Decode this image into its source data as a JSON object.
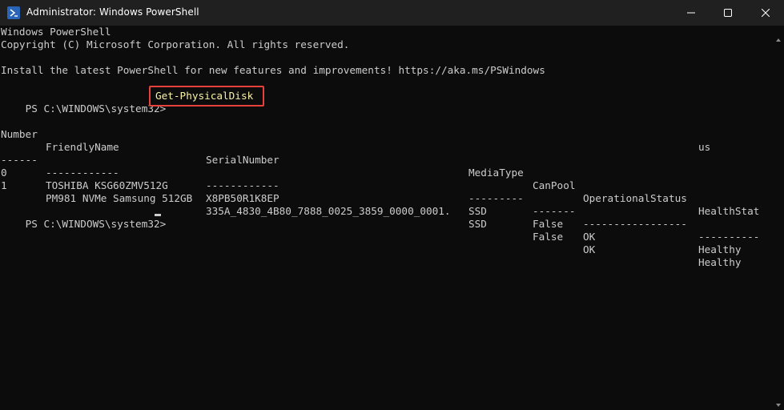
{
  "window": {
    "title": "Administrator: Windows PowerShell",
    "minimize_icon": "minimize-icon",
    "maximize_icon": "maximize-icon",
    "close_icon": "close-icon"
  },
  "console": {
    "banner_line1": "Windows PowerShell",
    "banner_line2": "Copyright (C) Microsoft Corporation. All rights reserved.",
    "banner_line3": "Install the latest PowerShell for new features and improvements! https://aka.ms/PSWindows",
    "prompt1": "PS C:\\WINDOWS\\system32>",
    "command": "Get-PhysicalDisk",
    "prompt2": "PS C:\\WINDOWS\\system32>"
  },
  "table": {
    "headers": {
      "number": "Number",
      "friendly_name": "FriendlyName",
      "serial_number": "SerialNumber",
      "media_type": "MediaType",
      "can_pool": "CanPool",
      "operational_status": "OperationalStatus",
      "health_status_a": "HealthStat",
      "health_status_b": "us"
    },
    "separators": {
      "number": "------",
      "friendly_name": "------------",
      "serial_number": "------------",
      "media_type": "---------",
      "can_pool": "-------",
      "operational_status": "-----------------",
      "health_status": "----------"
    },
    "rows": [
      {
        "number": "0",
        "friendly_name": "TOSHIBA KSG60ZMV512G",
        "serial_number": "X8PB50R1K8EP",
        "media_type": "SSD",
        "can_pool": "False",
        "operational_status": "OK",
        "health_status": "Healthy"
      },
      {
        "number": "1",
        "friendly_name": "PM981 NVMe Samsung 512GB",
        "serial_number": "335A_4830_4B80_7888_0025_3859_0000_0001.",
        "media_type": "SSD",
        "can_pool": "False",
        "operational_status": "OK",
        "health_status": "Healthy"
      }
    ]
  },
  "colors": {
    "background": "#0c0c0c",
    "titlebar": "#202020",
    "text": "#cccccc",
    "command": "#f9f1a5",
    "highlight_border": "#e8413b"
  }
}
